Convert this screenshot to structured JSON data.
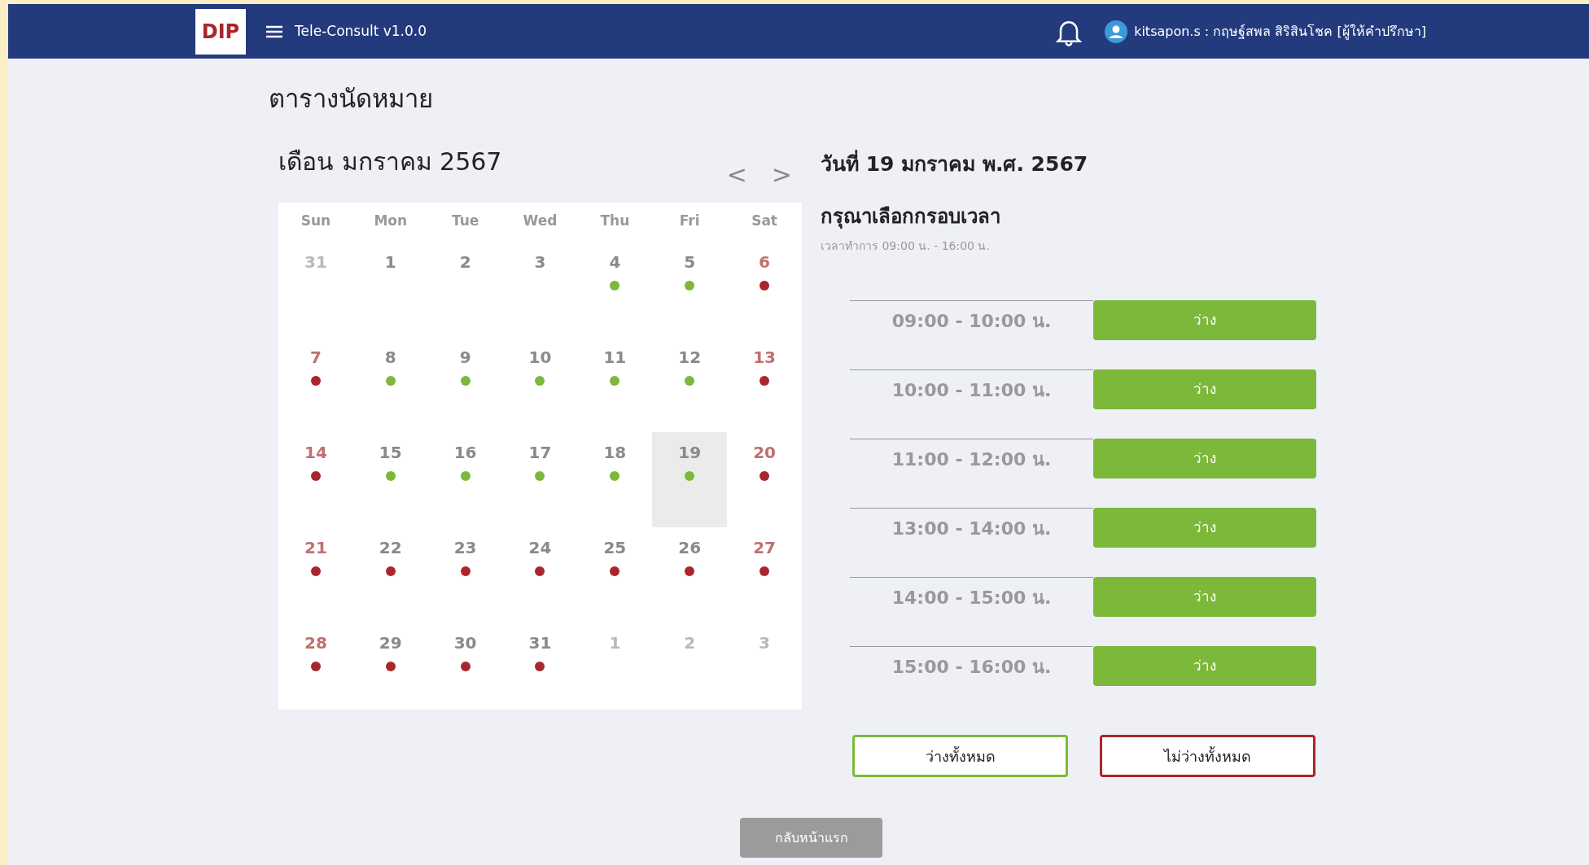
{
  "header": {
    "logo": "DIP",
    "app_title": "Tele-Consult v1.0.0",
    "user": "kitsapon.s : กฤษฐ์สพล สิริสินโชค [ผู้ให้คำปรึกษา]"
  },
  "page_title": "ตารางนัดหมาย",
  "calendar": {
    "month_title": "เดือน มกราคม 2567",
    "prev": "<",
    "next": ">",
    "weekdays": [
      "Sun",
      "Mon",
      "Tue",
      "Wed",
      "Thu",
      "Fri",
      "Sat"
    ],
    "weeks": [
      [
        {
          "day": "31",
          "muted": true,
          "selected": false
        },
        {
          "day": "1",
          "muted": false,
          "selected": false
        },
        {
          "day": "2",
          "muted": false,
          "selected": false
        },
        {
          "day": "3",
          "muted": false,
          "selected": false
        },
        {
          "day": "4",
          "muted": false,
          "selected": false,
          "color": "#7cb83a"
        },
        {
          "day": "5",
          "muted": false,
          "selected": false,
          "color": "#7cb83a"
        },
        {
          "day": "6",
          "muted": false,
          "selected": false,
          "color": "#a8262c"
        }
      ],
      [
        {
          "day": "7",
          "muted": false,
          "selected": false,
          "color": "#a8262c"
        },
        {
          "day": "8",
          "muted": false,
          "selected": false,
          "color": "#7cb83a"
        },
        {
          "day": "9",
          "muted": false,
          "selected": false,
          "color": "#7cb83a"
        },
        {
          "day": "10",
          "muted": false,
          "selected": false,
          "color": "#7cb83a"
        },
        {
          "day": "11",
          "muted": false,
          "selected": false,
          "color": "#7cb83a"
        },
        {
          "day": "12",
          "muted": false,
          "selected": false,
          "color": "#7cb83a"
        },
        {
          "day": "13",
          "muted": false,
          "selected": false,
          "color": "#a8262c"
        }
      ],
      [
        {
          "day": "14",
          "muted": false,
          "selected": false,
          "color": "#a8262c"
        },
        {
          "day": "15",
          "muted": false,
          "selected": false,
          "color": "#7cb83a"
        },
        {
          "day": "16",
          "muted": false,
          "selected": false,
          "color": "#7cb83a"
        },
        {
          "day": "17",
          "muted": false,
          "selected": false,
          "color": "#7cb83a"
        },
        {
          "day": "18",
          "muted": false,
          "selected": false,
          "color": "#7cb83a"
        },
        {
          "day": "19",
          "muted": false,
          "selected": true,
          "color": "#7cb83a"
        },
        {
          "day": "20",
          "muted": false,
          "selected": false,
          "color": "#a8262c"
        }
      ],
      [
        {
          "day": "21",
          "muted": false,
          "selected": false,
          "color": "#a8262c"
        },
        {
          "day": "22",
          "muted": false,
          "selected": false,
          "color": "#a8262c"
        },
        {
          "day": "23",
          "muted": false,
          "selected": false,
          "color": "#a8262c"
        },
        {
          "day": "24",
          "muted": false,
          "selected": false,
          "color": "#a8262c"
        },
        {
          "day": "25",
          "muted": false,
          "selected": false,
          "color": "#a8262c"
        },
        {
          "day": "26",
          "muted": false,
          "selected": false,
          "color": "#a8262c"
        },
        {
          "day": "27",
          "muted": false,
          "selected": false,
          "color": "#a8262c"
        }
      ],
      [
        {
          "day": "28",
          "muted": false,
          "selected": false,
          "color": "#a8262c"
        },
        {
          "day": "29",
          "muted": false,
          "selected": false,
          "color": "#a8262c"
        },
        {
          "day": "30",
          "muted": false,
          "selected": false,
          "color": "#a8262c"
        },
        {
          "day": "31",
          "muted": false,
          "selected": false,
          "color": "#a8262c"
        },
        {
          "day": "1",
          "muted": true,
          "selected": false
        },
        {
          "day": "2",
          "muted": true,
          "selected": false
        },
        {
          "day": "3",
          "muted": true,
          "selected": false
        }
      ]
    ]
  },
  "schedule": {
    "date_title": "วันที่ 19 มกราคม พ.ศ. 2567",
    "prompt": "กรุณาเลือกกรอบเวลา",
    "hours": "เวลาทำการ 09:00 น. - 16:00 น.",
    "slots": [
      {
        "time": "09:00 - 10:00 น.",
        "status": "ว่าง"
      },
      {
        "time": "10:00 - 11:00 น.",
        "status": "ว่าง"
      },
      {
        "time": "11:00 - 12:00 น.",
        "status": "ว่าง"
      },
      {
        "time": "13:00 - 14:00 น.",
        "status": "ว่าง"
      },
      {
        "time": "14:00 - 15:00 น.",
        "status": "ว่าง"
      },
      {
        "time": "15:00 - 16:00 น.",
        "status": "ว่าง"
      }
    ],
    "actions": [
      {
        "label": "ว่างทั้งหมด",
        "kind": "available"
      },
      {
        "label": "ไม่ว่างทั้งหมด",
        "kind": "unavailable"
      }
    ]
  },
  "back_button": "กลับหน้าแรก"
}
